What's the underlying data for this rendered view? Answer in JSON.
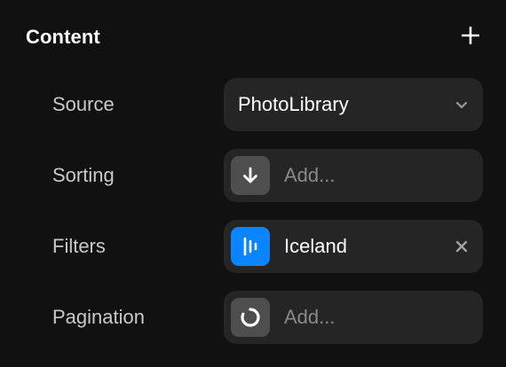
{
  "section": {
    "title": "Content",
    "add_icon": "plus-icon"
  },
  "rows": [
    {
      "label": "Source",
      "value": "PhotoLibrary",
      "icon": "chevron-down-icon"
    },
    {
      "label": "Sorting",
      "placeholder": "Add...",
      "icon": "arrow-down-icon"
    },
    {
      "label": "Filters",
      "value": "Iceland",
      "icon": "filter-bars-icon",
      "clear_icon": "close-icon"
    },
    {
      "label": "Pagination",
      "placeholder": "Add...",
      "icon": "loading-ring-icon"
    }
  ],
  "colors": {
    "background": "#111111",
    "field": "#252525",
    "accent": "#0a84ff",
    "icon_bg": "#4e4e4e",
    "label": "#c9c9c9",
    "placeholder": "#8a8a8a"
  }
}
